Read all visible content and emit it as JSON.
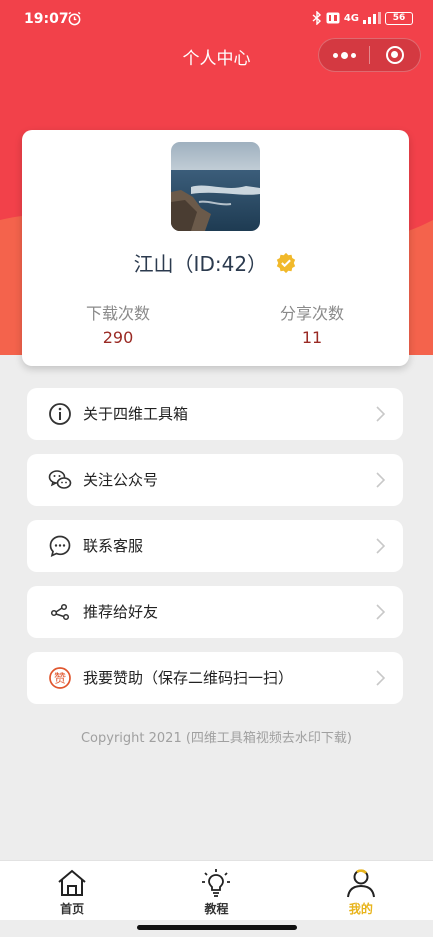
{
  "status_bar": {
    "time": "19:07",
    "network": "4G",
    "battery": "56"
  },
  "header": {
    "title": "个人中心"
  },
  "profile": {
    "username": "江山（ID:42）",
    "stats": [
      {
        "label": "下载次数",
        "value": "290"
      },
      {
        "label": "分享次数",
        "value": "11"
      }
    ]
  },
  "menu": [
    {
      "label": "关于四维工具箱",
      "icon": "info-icon"
    },
    {
      "label": "关注公众号",
      "icon": "wechat-icon"
    },
    {
      "label": "联系客服",
      "icon": "chat-bubble-icon"
    },
    {
      "label": "推荐给好友",
      "icon": "share-icon"
    },
    {
      "label": "我要赞助（保存二维码扫一扫）",
      "icon": "sponsor-icon"
    }
  ],
  "copyright": "Copyright 2021 (四维工具箱视频去水印下载)",
  "tabbar": {
    "tabs": [
      {
        "label": "首页",
        "icon": "home-icon"
      },
      {
        "label": "教程",
        "icon": "lightbulb-icon"
      },
      {
        "label": "我的",
        "icon": "user-icon",
        "active": true
      }
    ]
  },
  "colors": {
    "brand_red": "#f2414a",
    "active_tab": "#e8b41c",
    "stat_value": "#9a2a24"
  }
}
